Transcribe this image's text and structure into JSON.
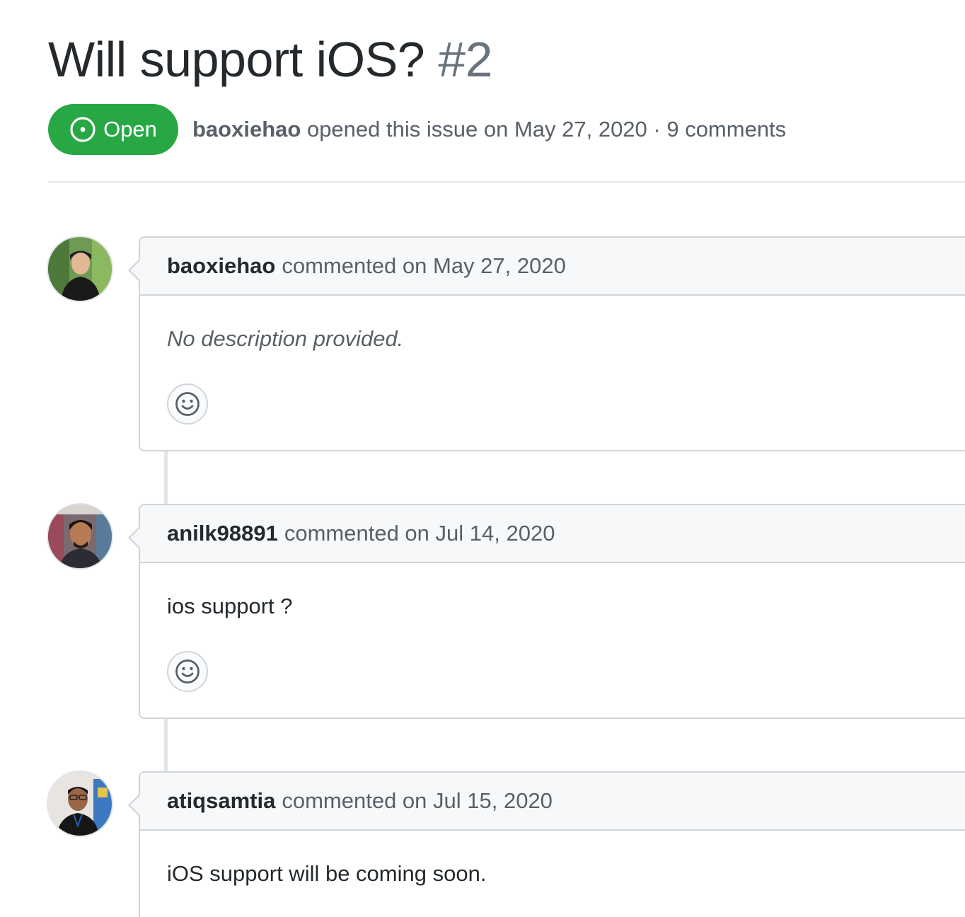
{
  "issue": {
    "title": "Will support iOS?",
    "number": "#2",
    "state": "Open",
    "author": "baoxiehao",
    "meta_text": "opened this issue on May 27, 2020 · 9 comments"
  },
  "icons": {
    "state": "issue-opened-icon",
    "reaction": "smiley-icon"
  },
  "colors": {
    "open_badge": "#28a745",
    "muted_text": "#586069",
    "border": "#d1d5da",
    "header_bg": "#f6f8fa"
  },
  "comments": [
    {
      "author": "baoxiehao",
      "meta": "commented on May 27, 2020",
      "body": "No description provided."
    },
    {
      "author": "anilk98891",
      "meta": "commented on Jul 14, 2020",
      "body": "ios support ?"
    },
    {
      "author": "atiqsamtia",
      "meta": "commented on Jul 15, 2020",
      "body": "iOS support will be coming soon."
    }
  ]
}
